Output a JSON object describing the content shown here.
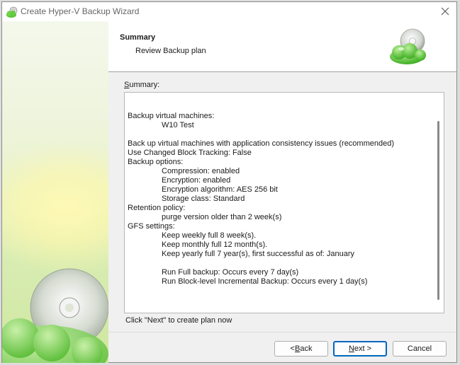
{
  "window": {
    "title": "Create Hyper-V Backup Wizard"
  },
  "header": {
    "title": "Summary",
    "subtitle": "Review Backup plan"
  },
  "summary": {
    "label": "Summary:",
    "lines": [
      {
        "text": "Backup virtual machines:",
        "indent": 0
      },
      {
        "text": "W10 Test",
        "indent": 1
      },
      {
        "text": "",
        "indent": 0
      },
      {
        "text": "Back up virtual machines with application consistency issues (recommended)",
        "indent": 0
      },
      {
        "text": "Use Changed Block Tracking: False",
        "indent": 0
      },
      {
        "text": "Backup options:",
        "indent": 0
      },
      {
        "text": "Compression: enabled",
        "indent": 1
      },
      {
        "text": "Encryption: enabled",
        "indent": 1
      },
      {
        "text": "Encryption algorithm: AES 256 bit",
        "indent": 1
      },
      {
        "text": "Storage class: Standard",
        "indent": 1
      },
      {
        "text": "Retention policy:",
        "indent": 0
      },
      {
        "text": "purge version older than 2 week(s)",
        "indent": 1
      },
      {
        "text": "GFS settings:",
        "indent": 0
      },
      {
        "text": "Keep weekly full 8 week(s).",
        "indent": 1
      },
      {
        "text": "Keep monthly full 12 month(s).",
        "indent": 1
      },
      {
        "text": "Keep yearly full 7 year(s), first successful as of: January",
        "indent": 1
      },
      {
        "text": "",
        "indent": 0
      },
      {
        "text": "Run Full backup: Occurs every 7 day(s)",
        "indent": 1
      },
      {
        "text": "Run Block-level Incremental Backup: Occurs every 1 day(s)",
        "indent": 1
      }
    ]
  },
  "hint": "Click \"Next\" to create plan now",
  "buttons": {
    "back": {
      "pre": "< ",
      "accel": "B",
      "post": "ack"
    },
    "next": {
      "pre": "",
      "accel": "N",
      "post": "ext >"
    },
    "cancel": "Cancel"
  },
  "icons": {
    "app": "green-cloud-disc-icon",
    "header": "green-cloud-disc-icon",
    "close": "close-icon"
  },
  "colors": {
    "accent": "#0067c0",
    "cloud_green": "#5cc43a"
  }
}
